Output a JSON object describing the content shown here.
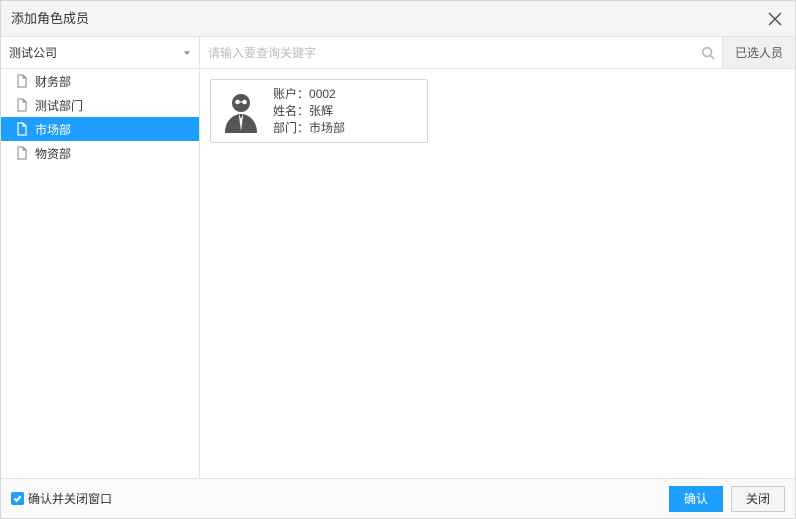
{
  "title": "添加角色成员",
  "org_selected": "测试公司",
  "search": {
    "placeholder": "请输入要查询关键字"
  },
  "selected_btn_label": "已选人员",
  "tree": [
    {
      "label": "财务部",
      "selected": false
    },
    {
      "label": "测试部门",
      "selected": false
    },
    {
      "label": "市场部",
      "selected": true
    },
    {
      "label": "物资部",
      "selected": false
    }
  ],
  "labels": {
    "account": "账户：",
    "name": "姓名：",
    "dept": "部门："
  },
  "user": {
    "account": "0002",
    "name": "张辉",
    "dept": "市场部"
  },
  "footer": {
    "checkbox_label": "确认并关闭窗口",
    "ok": "确认",
    "cancel": "关闭"
  }
}
